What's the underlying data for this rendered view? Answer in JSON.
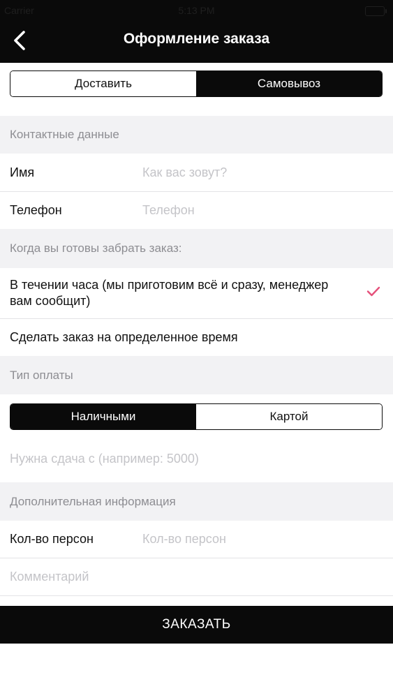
{
  "status_bar": {
    "carrier": "Carrier",
    "time": "5:13 PM"
  },
  "header": {
    "title": "Оформление заказа",
    "back_icon": "chevron-left-icon"
  },
  "delivery_toggle": {
    "options": [
      {
        "label": "Доставить",
        "selected": false
      },
      {
        "label": "Самовывоз",
        "selected": true
      }
    ]
  },
  "contacts": {
    "section_title": "Контактные данные",
    "name": {
      "label": "Имя",
      "placeholder": "Как вас зовут?"
    },
    "phone": {
      "label": "Телефон",
      "placeholder": "Телефон"
    }
  },
  "pickup_time": {
    "section_title": "Когда вы готовы забрать заказ:",
    "options": [
      {
        "label": "В течении часа (мы приготовим всё и сразу, менеджер вам сообщит)",
        "selected": true
      },
      {
        "label": "Сделать заказ на определенное время",
        "selected": false
      }
    ],
    "check_color": "#e5507a"
  },
  "payment": {
    "section_title": "Тип оплаты",
    "options": [
      {
        "label": "Наличными",
        "selected": true
      },
      {
        "label": "Картой",
        "selected": false
      }
    ],
    "change_placeholder": "Нужна сдача с (например: 5000)"
  },
  "extra": {
    "section_title": "Дополнительная информация",
    "persons": {
      "label": "Кол-во персон",
      "placeholder": "Кол-во персон"
    },
    "comment_placeholder": "Комментарий"
  },
  "order_button": {
    "label": "ЗАКАЗАТЬ"
  }
}
